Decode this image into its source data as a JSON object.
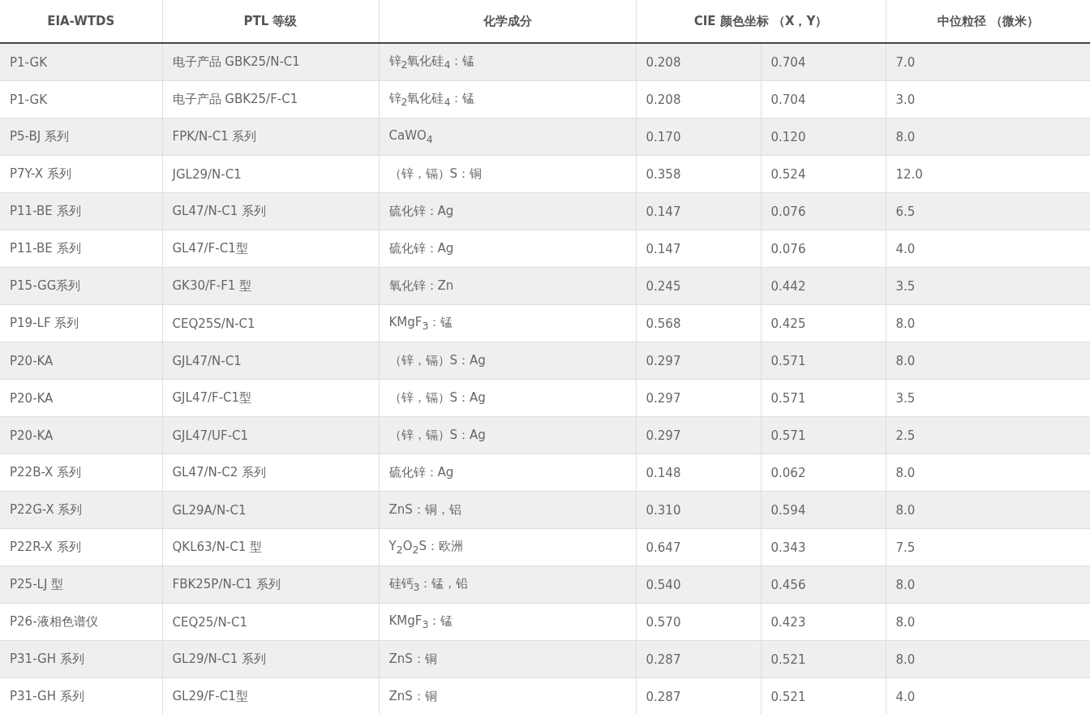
{
  "table": {
    "columns": [
      "EIA-WTDS",
      "PTL 等级",
      "化学成分",
      "CIE 颜色坐标 （X，Y）",
      "中位粒径 （微米）"
    ],
    "rows": [
      {
        "cells": [
          "P1-GK",
          "电子产品 GBK25/N-C1",
          "锌$_{2}$氧化硅$_{4}$：锰",
          [
            "0.208",
            "0.704"
          ],
          "7.0"
        ]
      },
      {
        "cells": [
          "P1-GK",
          "电子产品 GBK25/F-C1",
          "锌$_{2}$氧化硅$_{4}$：锰",
          [
            "0.208",
            "0.704"
          ],
          "3.0"
        ]
      },
      {
        "cells": [
          "P5-BJ 系列",
          "FPK/N-C1 系列",
          "CaWO$_{4}$",
          [
            "0.170",
            "0.120"
          ],
          "8.0"
        ]
      },
      {
        "cells": [
          "P7Y-X 系列",
          "JGL29/N-C1",
          "（锌，镉）S：铜",
          [
            "0.358",
            "0.524"
          ],
          "12.0"
        ]
      },
      {
        "cells": [
          "P11-BE 系列",
          "GL47/N-C1 系列",
          "硫化锌：Ag",
          [
            "0.147",
            "0.076"
          ],
          "6.5"
        ]
      },
      {
        "cells": [
          "P11-BE 系列",
          "GL47/F-C1型",
          "硫化锌：Ag",
          [
            "0.147",
            "0.076"
          ],
          "4.0"
        ]
      },
      {
        "cells": [
          "P15-GG系列",
          "GK30/F-F1 型",
          "氧化锌：Zn",
          [
            "0.245",
            "0.442"
          ],
          "3.5"
        ]
      },
      {
        "cells": [
          "P19-LF 系列",
          "CEQ25S/N-C1",
          "KMgF$_{3}$：锰",
          [
            "0.568",
            "0.425"
          ],
          "8.0"
        ]
      },
      {
        "cells": [
          "P20-KA",
          "GJL47/N-C1",
          "（锌，镉）S：Ag",
          [
            "0.297",
            "0.571"
          ],
          "8.0"
        ]
      },
      {
        "cells": [
          "P20-KA",
          "GJL47/F-C1型",
          "（锌，镉）S：Ag",
          [
            "0.297",
            "0.571"
          ],
          "3.5"
        ]
      },
      {
        "cells": [
          "P20-KA",
          "GJL47/UF-C1",
          "（锌，镉）S：Ag",
          [
            "0.297",
            "0.571"
          ],
          "2.5"
        ]
      },
      {
        "cells": [
          "P22B-X 系列",
          "GL47/N-C2 系列",
          "硫化锌：Ag",
          [
            "0.148",
            "0.062"
          ],
          "8.0"
        ]
      },
      {
        "cells": [
          "P22G-X 系列",
          "GL29A/N-C1",
          "ZnS：铜，铝",
          [
            "0.310",
            "0.594"
          ],
          "8.0"
        ]
      },
      {
        "cells": [
          "P22R-X 系列",
          "QKL63/N-C1 型",
          "Y$_{2}$O$_{2}$S：欧洲",
          [
            "0.647",
            "0.343"
          ],
          "7.5"
        ]
      },
      {
        "cells": [
          "P25-LJ 型",
          "FBK25P/N-C1 系列",
          "硅钙$_{3}$：锰，铅",
          [
            "0.540",
            "0.456"
          ],
          "8.0"
        ]
      },
      {
        "cells": [
          "P26-液相色谱仪",
          "CEQ25/N-C1",
          "KMgF$_{3}$：锰",
          [
            "0.570",
            "0.423"
          ],
          "8.0"
        ]
      },
      {
        "cells": [
          "P31-GH 系列",
          "GL29/N-C1 系列",
          "ZnS：铜",
          [
            "0.287",
            "0.521"
          ],
          "8.0"
        ]
      },
      {
        "cells": [
          "P31-GH 系列",
          "GL29/F-C1型",
          "ZnS：铜",
          [
            "0.287",
            "0.521"
          ],
          "4.0"
        ]
      }
    ]
  }
}
